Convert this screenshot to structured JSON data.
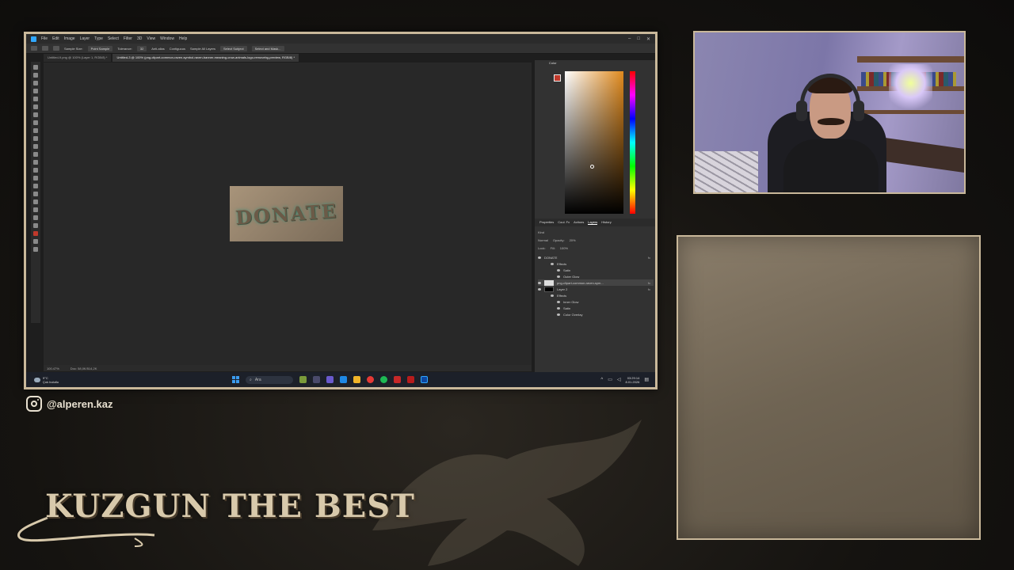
{
  "photoshop": {
    "menu": [
      "File",
      "Edit",
      "Image",
      "Layer",
      "Type",
      "Select",
      "Filter",
      "3D",
      "View",
      "Window",
      "Help"
    ],
    "options": {
      "sample_size_label": "Sample Size:",
      "sample_size_value": "Point Sample",
      "tolerance_label": "Tolerance:",
      "tolerance_value": "32",
      "antialias": "Anti-alias",
      "contiguous": "Contiguous",
      "sample_all_layers": "Sample All Layers",
      "select_subject": "Select Subject",
      "select_and_mask": "Select and Mask..."
    },
    "tabs": [
      "Untitled-9.png @ 100% (Layer 1, RGB/8) *",
      "Untitled-3 @ 100% (png-clipart-common-raven-symbol-raven-banner-meaning-crow-animals-logo-removebg-preview, RGB/8) *"
    ],
    "canvas_text": "DONATE",
    "status_zoom": "100.47%",
    "status_doc": "Doc: 58,0K/514,2K",
    "panels": {
      "color_tab": "Color",
      "layer_tabs": [
        "Properties",
        "Coul. Fx",
        "Actions",
        "Layers",
        "History"
      ],
      "kind_label": "Kind",
      "blend_mode": "Normal",
      "opacity_label": "Opacity:",
      "opacity_value": "20%",
      "lock_label": "Lock:",
      "fill_label": "Fill:",
      "fill_value": "100%",
      "layers": [
        {
          "name": "DONATE",
          "fx": "fx"
        },
        {
          "name": "Effects"
        },
        {
          "name": "Satin"
        },
        {
          "name": "Outer Glow"
        },
        {
          "name": "png-clipart-common-raven-sym...",
          "fx": "fx"
        },
        {
          "name": "Layer 2",
          "fx": "fx"
        },
        {
          "name": "Effects"
        },
        {
          "name": "Inner Glow"
        },
        {
          "name": "Satin"
        },
        {
          "name": "Color Overlay"
        }
      ]
    }
  },
  "taskbar": {
    "weather_temp": "9°C",
    "weather_desc": "Çok bulutlu",
    "search_placeholder": "Ara",
    "time": "03:29:14",
    "date": "8.01.2026"
  },
  "social": {
    "handle": "@alperen.kaz"
  },
  "brand": {
    "title": "KUZGUN THE BEST"
  },
  "colors": {
    "frame": "#c9b89a",
    "accent_red": "#c0392b",
    "panel_bg": "#6f6453"
  }
}
